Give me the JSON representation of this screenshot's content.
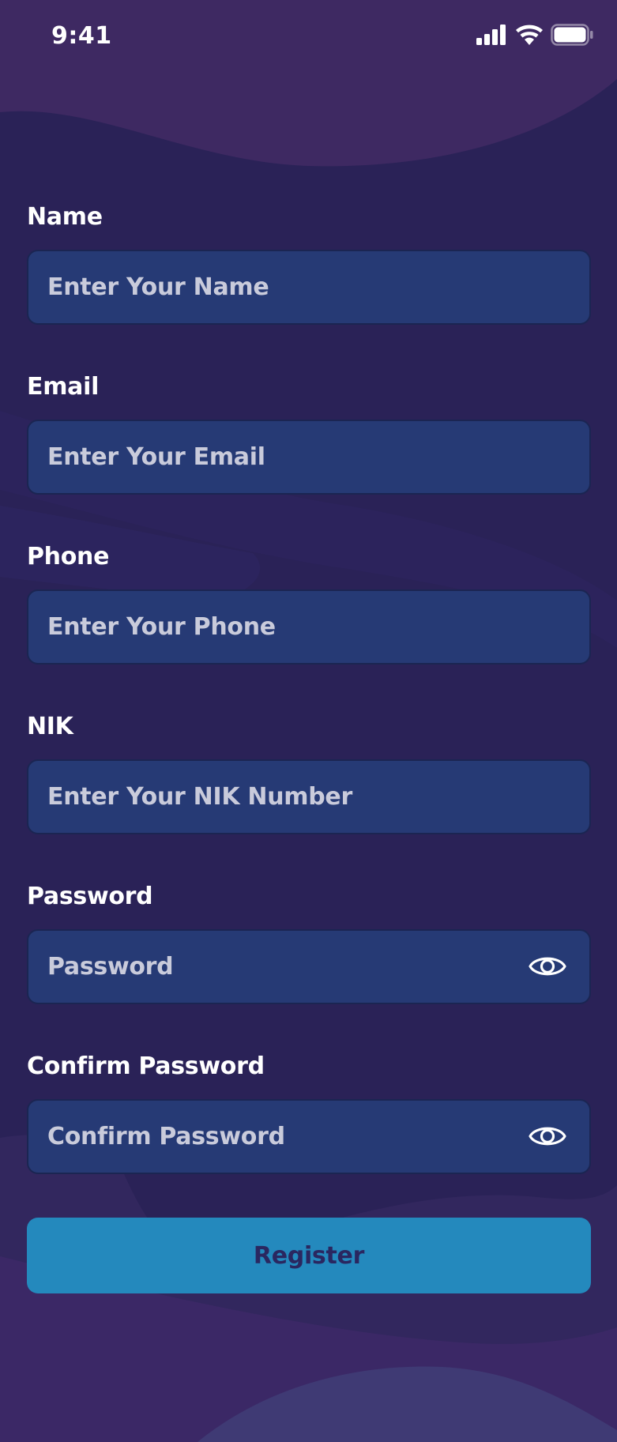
{
  "status_bar": {
    "time": "9:41",
    "icons": [
      "signal-icon",
      "wifi-icon",
      "battery-icon"
    ]
  },
  "form": {
    "fields": [
      {
        "label": "Name",
        "placeholder": "Enter Your Name",
        "value": ""
      },
      {
        "label": "Email",
        "placeholder": "Enter Your Email",
        "value": ""
      },
      {
        "label": "Phone",
        "placeholder": "Enter Your Phone",
        "value": ""
      },
      {
        "label": "NIK",
        "placeholder": "Enter Your NIK Number",
        "value": ""
      },
      {
        "label": "Password",
        "placeholder": "Password",
        "value": "",
        "toggle_icon": "eye-icon"
      },
      {
        "label": "Confirm Password",
        "placeholder": "Confirm Password",
        "value": "",
        "toggle_icon": "eye-icon"
      }
    ],
    "submit_label": "Register"
  },
  "colors": {
    "background": "#2a2257",
    "input_fill": "#263a75",
    "input_border": "#1b2552",
    "button_fill": "#2489bd",
    "button_text": "#2a2760",
    "label_text": "#ffffff",
    "placeholder_text": "#c9cbdb"
  }
}
